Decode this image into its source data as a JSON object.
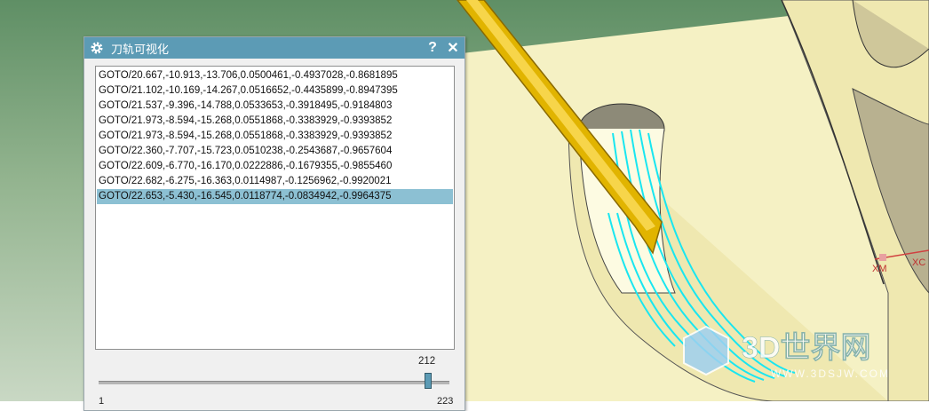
{
  "dialog": {
    "title": "刀轨可视化",
    "help_label": "?",
    "close_label": "✕",
    "rows": [
      "GOTO/20.667,-10.913,-13.706,0.0500461,-0.4937028,-0.8681895",
      "GOTO/21.102,-10.169,-14.267,0.0516652,-0.4435899,-0.8947395",
      "GOTO/21.537,-9.396,-14.788,0.0533653,-0.3918495,-0.9184803",
      "GOTO/21.973,-8.594,-15.268,0.0551868,-0.3383929,-0.9393852",
      "GOTO/21.973,-8.594,-15.268,0.0551868,-0.3383929,-0.9393852",
      "GOTO/22.360,-7.707,-15.723,0.0510238,-0.2543687,-0.9657604",
      "GOTO/22.609,-6.770,-16.170,0.0222886,-0.1679355,-0.9855460",
      "GOTO/22.682,-6.275,-16.363,0.0114987,-0.1256962,-0.9920021",
      "GOTO/22.653,-5.430,-16.545,0.0118774,-0.0834942,-0.9964375"
    ],
    "selected_index": 8,
    "slider": {
      "value": "212",
      "min": "1",
      "max": "223"
    }
  },
  "viewport": {
    "axis_xm": "XM",
    "axis_xc": "XC",
    "watermark_brand": "3D世界网",
    "watermark_url": "WWW.3DSJW.COM"
  }
}
